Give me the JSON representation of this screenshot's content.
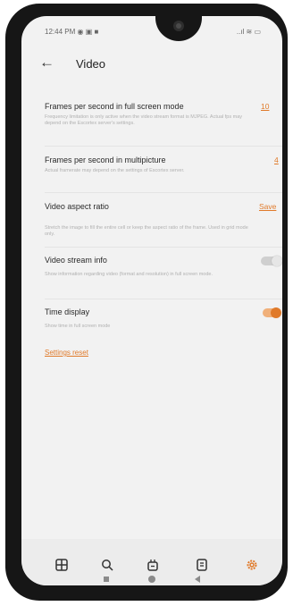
{
  "status": {
    "time": "12:44 PM",
    "icons_left": "◉ ▣ ■",
    "icons_right": "..ıl ≋ ▭"
  },
  "header": {
    "back_icon": "←",
    "title": "Video"
  },
  "settings": [
    {
      "title": "Frames per second in full screen mode",
      "description": "Frequency limitation is only active when the video stream format is MJPEG. Actual fps may depend on the Escortex server's settings.",
      "value": "10"
    },
    {
      "title": "Frames per second in multipicture",
      "description": "Actual framerate may depend on the settings of Escortex server.",
      "value": "4"
    },
    {
      "title": "Video aspect ratio",
      "description": "Stretch the image to fill the entire cell or keep the aspect ratio of the frame. Used in grid mode only.",
      "value": "Save"
    },
    {
      "title": "Video stream info",
      "description": "Show information regarding video (format and resolution) in full screen mode.",
      "toggle": false
    },
    {
      "title": "Time display",
      "description": "Show time in full screen mode",
      "toggle": true
    }
  ],
  "reset_label": "Settings reset",
  "colors": {
    "accent": "#e07a2a",
    "nav_icon": "#333333"
  },
  "bottom_nav": [
    {
      "icon": "grid-icon",
      "active": false
    },
    {
      "icon": "search-icon",
      "active": false
    },
    {
      "icon": "camera-robot-icon",
      "active": false
    },
    {
      "icon": "document-icon",
      "active": false
    },
    {
      "icon": "gear-icon",
      "active": true
    }
  ]
}
